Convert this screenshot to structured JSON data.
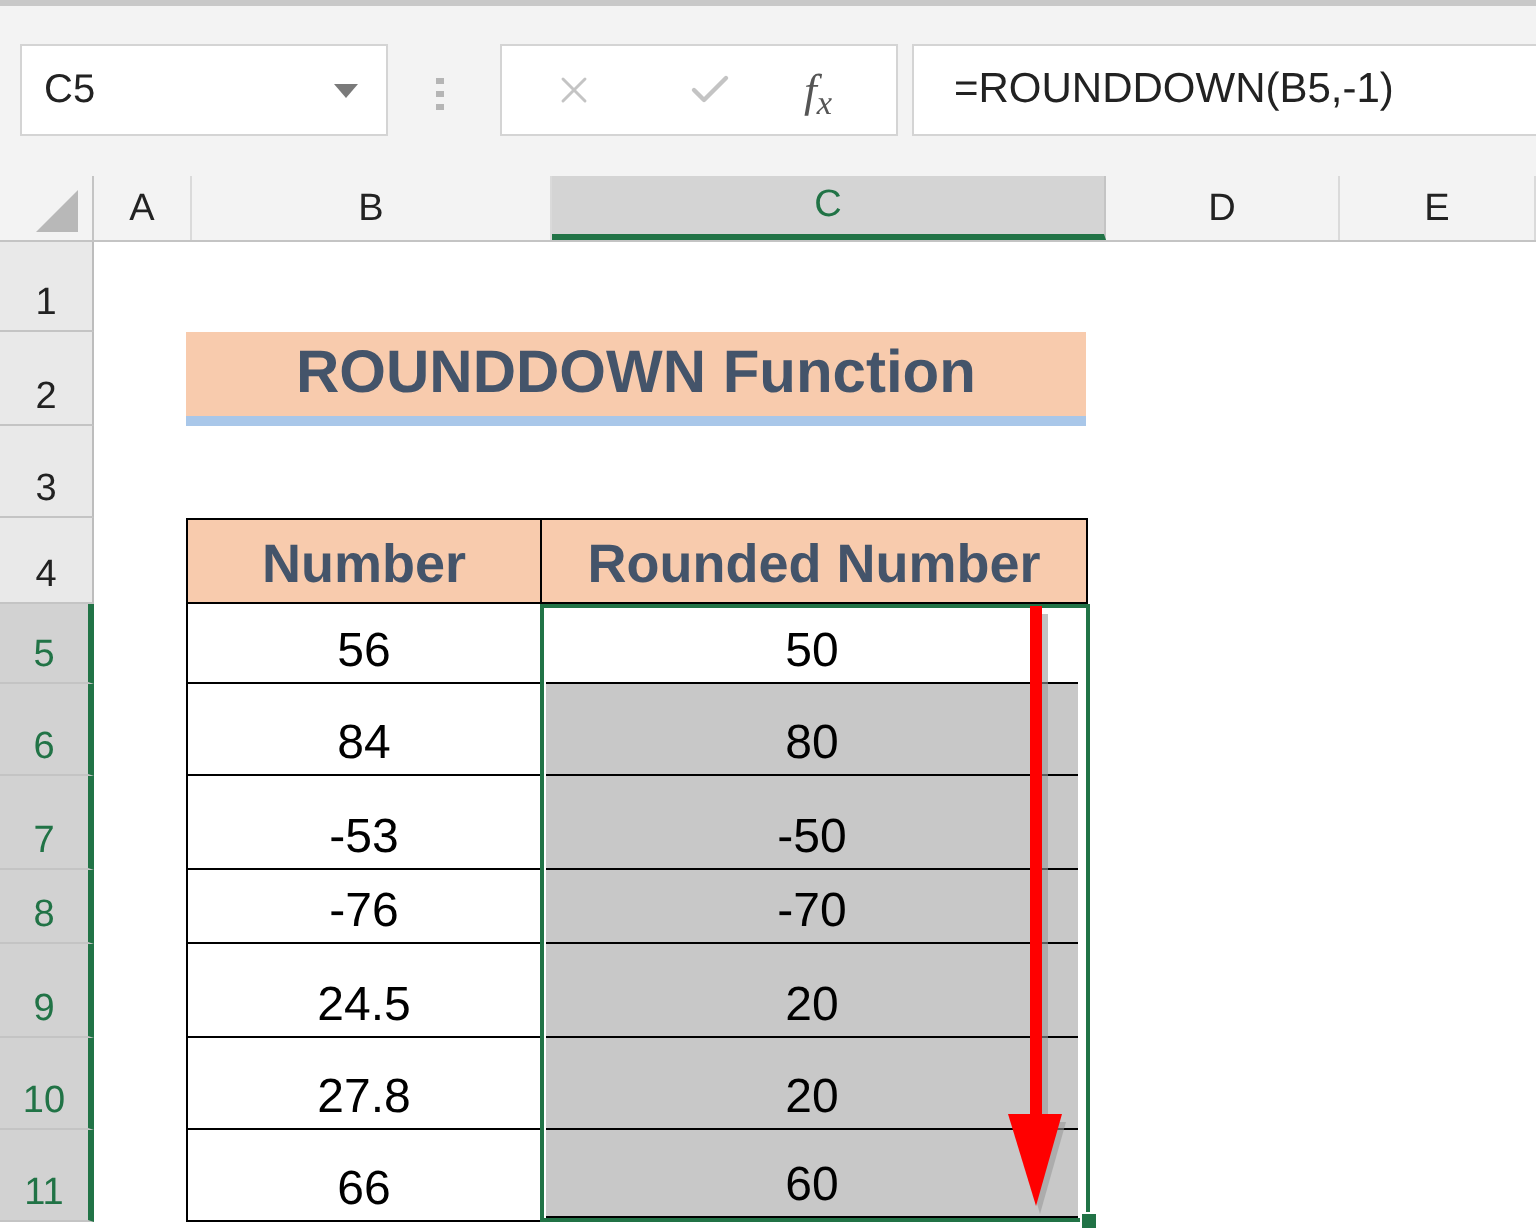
{
  "name_box": {
    "value": "C5"
  },
  "formula_bar": {
    "cancel": {
      "disabled": true
    },
    "enter": {
      "disabled": true
    },
    "function_label": "f$_{x}$",
    "value": "=ROUNDDOWN(B5,-1)"
  },
  "columns": [
    {
      "label": "A",
      "selected": false
    },
    {
      "label": "B",
      "selected": false
    },
    {
      "label": "C",
      "selected": true
    },
    {
      "label": "D",
      "selected": false
    },
    {
      "label": "E",
      "selected": false
    }
  ],
  "rows": [
    {
      "label": "1",
      "selected": false
    },
    {
      "label": "2",
      "selected": false
    },
    {
      "label": "3",
      "selected": false
    },
    {
      "label": "4",
      "selected": false
    },
    {
      "label": "5",
      "selected": true
    },
    {
      "label": "6",
      "selected": true
    },
    {
      "label": "7",
      "selected": true
    },
    {
      "label": "8",
      "selected": true
    },
    {
      "label": "9",
      "selected": true
    },
    {
      "label": "10",
      "selected": true
    },
    {
      "label": "11",
      "selected": true
    }
  ],
  "title": "ROUNDDOWN Function",
  "table": {
    "columns": [
      "Number",
      "Rounded Number"
    ],
    "rows": [
      {
        "number": "56",
        "rounded": "50",
        "selected": true,
        "active": true
      },
      {
        "number": "84",
        "rounded": "80",
        "selected": true,
        "active": false
      },
      {
        "number": "-53",
        "rounded": "-50",
        "selected": true,
        "active": false
      },
      {
        "number": "-76",
        "rounded": "-70",
        "selected": true,
        "active": false
      },
      {
        "number": "24.5",
        "rounded": "20",
        "selected": true,
        "active": false
      },
      {
        "number": "27.8",
        "rounded": "20",
        "selected": true,
        "active": false
      },
      {
        "number": "66",
        "rounded": "60",
        "selected": true,
        "active": false
      }
    ]
  }
}
